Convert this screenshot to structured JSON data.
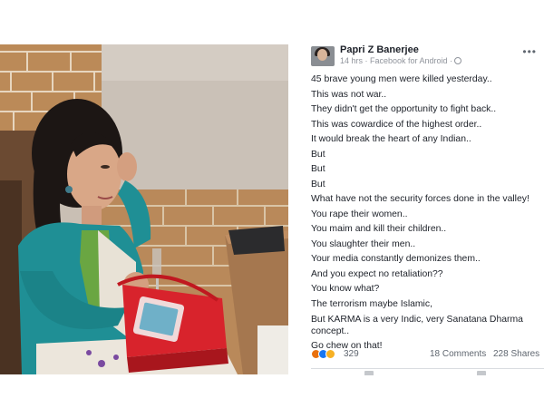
{
  "post": {
    "author": "Papri Z Banerjee",
    "meta": "14 hrs · Facebook for Android ·",
    "lines": [
      "45 brave young men were killed yesterday..",
      "This was not war..",
      "They didn't get the opportunity to fight back..",
      "This was cowardice of the highest order..",
      "It would break the heart of any Indian..",
      "But",
      "But",
      "But",
      "What have not the security forces done in the valley!",
      "You rape their women..",
      "You maim and kill their children..",
      "You slaughter their men..",
      "Your media constantly demonizes them..",
      "And you expect no retaliation??",
      "You know what?",
      "The terrorism maybe Islamic,",
      "But KARMA is a very Indic, very Sanatana Dharma concept..",
      "Go chew on that!"
    ],
    "reactions_count": "329",
    "comments": "18 Comments",
    "shares": "228 Shares",
    "reaction_icons": [
      "angry-icon",
      "like-icon",
      "haha-icon"
    ]
  },
  "colors": {
    "text": "#1d2129",
    "meta": "#90949c",
    "link": "#606770",
    "brick": "#b98a5c",
    "cardigan": "#1f8f95",
    "bag": "#d8232c"
  }
}
